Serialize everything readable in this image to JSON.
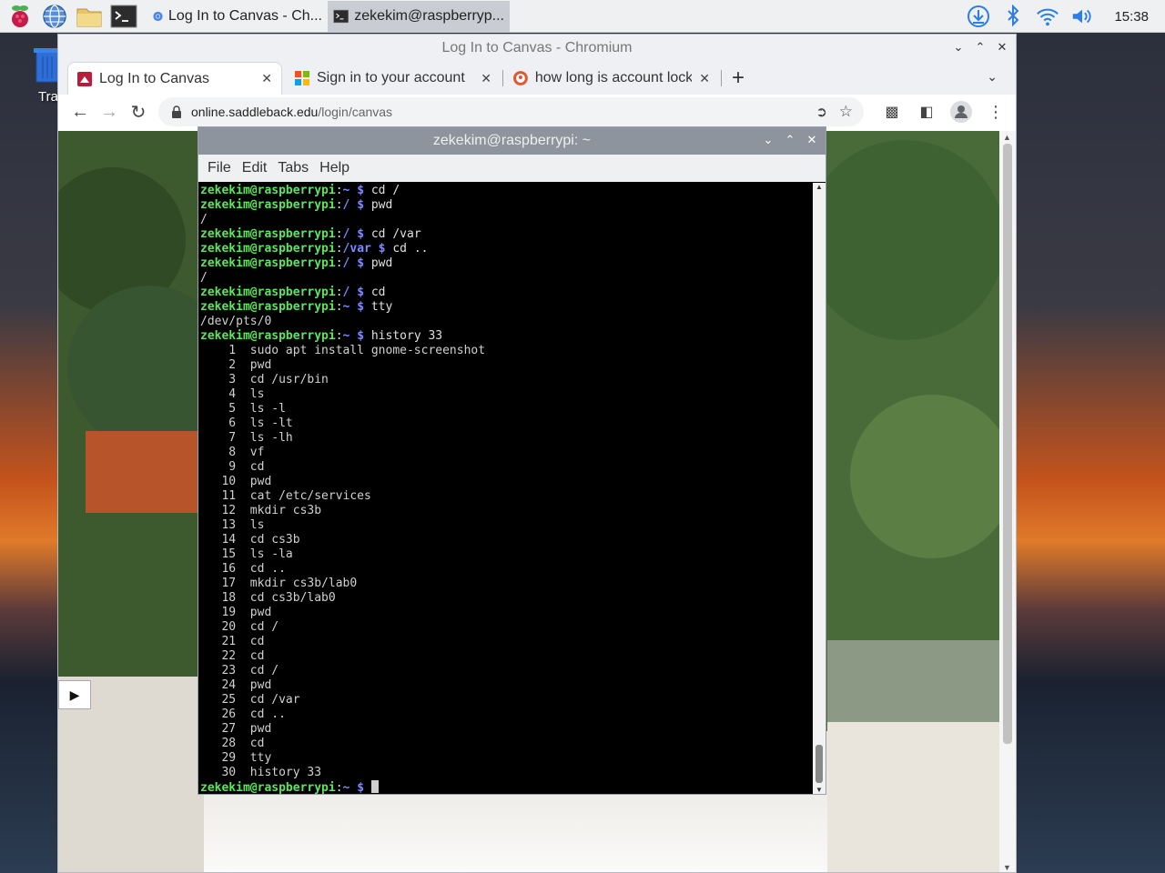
{
  "taskbar": {
    "tasks": [
      {
        "label": "Log In to Canvas - Ch...",
        "icon": "chromium-icon"
      },
      {
        "label": "zekekim@raspberryp...",
        "icon": "terminal-icon"
      }
    ],
    "clock": "15:38"
  },
  "desktop": {
    "trash_label": "Tra"
  },
  "chromium": {
    "title": "Log In to Canvas - Chromium",
    "tabs": [
      {
        "label": "Log In to Canvas"
      },
      {
        "label": "Sign in to your account"
      },
      {
        "label": "how long is account lock"
      }
    ],
    "url_host": "online.saddleback.edu",
    "url_path": "/login/canvas"
  },
  "terminal": {
    "title": "zekekim@raspberrypi: ~",
    "menu": [
      "File",
      "Edit",
      "Tabs",
      "Help"
    ],
    "prompt_user": "zekekim@raspberrypi",
    "lines": [
      {
        "dir": "~",
        "cmd": "cd /"
      },
      {
        "dir": "/",
        "cmd": "pwd"
      },
      {
        "out": "/"
      },
      {
        "dir": "/",
        "cmd": "cd /var"
      },
      {
        "dir": "/var",
        "cmd": "cd .."
      },
      {
        "dir": "/",
        "cmd": "pwd"
      },
      {
        "out": "/"
      },
      {
        "dir": "/",
        "cmd": "cd"
      },
      {
        "dir": "~",
        "cmd": "tty"
      },
      {
        "out": "/dev/pts/0"
      },
      {
        "dir": "~",
        "cmd": "history 33"
      },
      {
        "out": "    1  sudo apt install gnome-screenshot"
      },
      {
        "out": "    2  pwd"
      },
      {
        "out": "    3  cd /usr/bin"
      },
      {
        "out": "    4  ls"
      },
      {
        "out": "    5  ls -l"
      },
      {
        "out": "    6  ls -lt"
      },
      {
        "out": "    7  ls -lh"
      },
      {
        "out": "    8  vf"
      },
      {
        "out": "    9  cd"
      },
      {
        "out": "   10  pwd"
      },
      {
        "out": "   11  cat /etc/services"
      },
      {
        "out": "   12  mkdir cs3b"
      },
      {
        "out": "   13  ls"
      },
      {
        "out": "   14  cd cs3b"
      },
      {
        "out": "   15  ls -la"
      },
      {
        "out": "   16  cd .."
      },
      {
        "out": "   17  mkdir cs3b/lab0"
      },
      {
        "out": "   18  cd cs3b/lab0"
      },
      {
        "out": "   19  pwd"
      },
      {
        "out": "   20  cd /"
      },
      {
        "out": "   21  cd"
      },
      {
        "out": "   22  cd"
      },
      {
        "out": "   23  cd /"
      },
      {
        "out": "   24  pwd"
      },
      {
        "out": "   25  cd /var"
      },
      {
        "out": "   26  cd .."
      },
      {
        "out": "   27  pwd"
      },
      {
        "out": "   28  cd"
      },
      {
        "out": "   29  tty"
      },
      {
        "out": "   30  history 33"
      },
      {
        "dir": "~",
        "cmd": "",
        "cursor": true
      }
    ]
  }
}
